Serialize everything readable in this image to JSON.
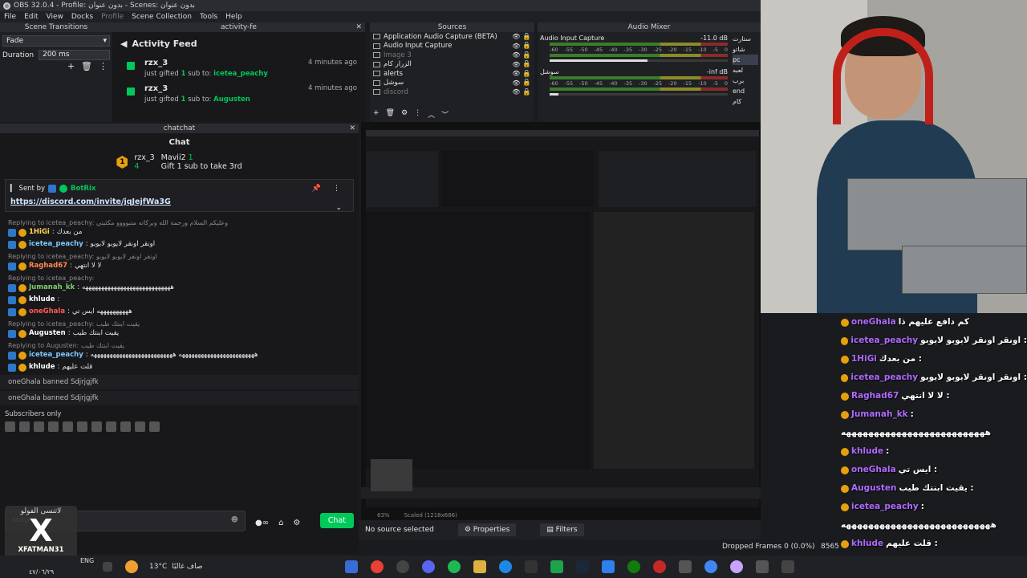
{
  "window": {
    "title": "OBS 32.0.4 - Profile: بدون عنوان - Scenes: بدون عنوان"
  },
  "menu": [
    "File",
    "Edit",
    "View",
    "Docks",
    "Profile",
    "Scene Collection",
    "Tools",
    "Help"
  ],
  "docks": {
    "scene_transitions": "Scene Transitions",
    "activity_feed_title": "activity-fe",
    "sources": "Sources",
    "audio_mixer": "Audio Mixer",
    "chat_dock": "chatchat"
  },
  "transitions": {
    "type": "Fade",
    "duration_label": "Duration",
    "duration_value": "200 ms"
  },
  "activity": {
    "heading": "Activity Feed",
    "items": [
      {
        "user": "rzx_3",
        "prefix": "just gifted",
        "count": "1",
        "mid": "sub to:",
        "target": "icetea_peachy",
        "time": "4 minutes ago"
      },
      {
        "user": "rzx_3",
        "prefix": "just gifted",
        "count": "1",
        "mid": "sub to:",
        "target": "Augusten",
        "time": "4 minutes ago"
      }
    ]
  },
  "sources": [
    {
      "name": "Application Audio Capture (BETA)",
      "dim": false
    },
    {
      "name": "Audio Input Capture",
      "dim": false
    },
    {
      "name": "Image 3",
      "dim": true
    },
    {
      "name": "الزرار كام",
      "dim": false
    },
    {
      "name": "alerts",
      "dim": false
    },
    {
      "name": "سوشل",
      "dim": false
    },
    {
      "name": "discord",
      "dim": true
    }
  ],
  "mixer": {
    "channels": [
      {
        "name": "Audio Input Capture",
        "db": "-11.0 dB",
        "level": 0.55
      },
      {
        "name": "سوشل",
        "db": "-inf dB",
        "level": 0.05
      }
    ],
    "ticks": [
      "-60",
      "-55",
      "-50",
      "-45",
      "-40",
      "-35",
      "-30",
      "-25",
      "-20",
      "-15",
      "-10",
      "-5",
      "0"
    ]
  },
  "scenes": [
    "ستارت",
    "شاتو",
    "pc",
    "لعبه",
    "برب",
    "end",
    "كام"
  ],
  "scenes_selected": "pc",
  "chat": {
    "heading": "Chat",
    "hype_rank": "1",
    "hype_user1": "rzx_3",
    "hype_user1_val": "4",
    "hype_user2": "Mavii2",
    "hype_user2_val": "1",
    "hype_sub": "Gift 1 sub to take 3rd",
    "pinned_label": "Sent by",
    "pinned_user": "BotRix",
    "pinned_link": "https://discord.com/invite/jqJejfWa3G",
    "messages": [
      {
        "kind": "reply",
        "text": "Replying to icetea_peachy: وعليكم السلام ورحمة الله وبركاته متبوووو مكثيني"
      },
      {
        "kind": "msg",
        "user": "1HiGi",
        "color": "#ffd84d",
        "text": "من بعدك"
      },
      {
        "kind": "msg",
        "user": "icetea_peachy",
        "color": "#7ec8ff",
        "text": "اونقر اونقر لايوبو لايوبو"
      },
      {
        "kind": "reply",
        "text": "Replying to icetea_peachy: اونقر اونقر لايوبو لايوبو"
      },
      {
        "kind": "msg",
        "user": "Raghad67",
        "color": "#ff8a4d",
        "text": "لا لا انتهي"
      },
      {
        "kind": "reply",
        "text": "Replying to icetea_peachy:"
      },
      {
        "kind": "msg",
        "user": "Jumanah_kk",
        "color": "#7ecf6a",
        "text": "ههههههههههههههههههههههههههههه"
      },
      {
        "kind": "msg",
        "user": "khlude",
        "color": "#ffffff",
        "text": ""
      },
      {
        "kind": "msg",
        "user": "oneGhala",
        "color": "#ff5a5a",
        "text": "ههههههههههه ايس تي"
      },
      {
        "kind": "reply",
        "text": "Replying to icetea_peachy: يقيت ابنتك طيب"
      },
      {
        "kind": "msg",
        "user": "Augusten",
        "color": "#ffffff",
        "text": "يقيت ابنتك طيب"
      },
      {
        "kind": "reply",
        "text": "Replying to Augusten: يقيت ابنتك طيب"
      },
      {
        "kind": "msg",
        "user": "icetea_peachy",
        "color": "#7ec8ff",
        "text": "ههههههههههههههههههههههههه ههههههههههههههههههههههههههه"
      },
      {
        "kind": "msg",
        "user": "khlude",
        "color": "#ffffff",
        "text": "قلت عليهم"
      }
    ],
    "system": [
      "oneGhala banned Sdjrjgjfk",
      "oneGhala banned Sdjrjgjfk"
    ],
    "subs_only": "Subscribers only",
    "input_placeholder": "ssage",
    "send_label": "Chat"
  },
  "preview": {
    "zoom": "63%",
    "scaled": "Scaled (1218x686)"
  },
  "bottom": {
    "no_source": "No source selected",
    "properties": "Properties",
    "filters": "Filters",
    "dropped": "Dropped Frames 0 (0.0%)",
    "bitrate": "8565"
  },
  "overlay": [
    {
      "user": "oneGhala",
      "text": "كم دافع عليهم ذا"
    },
    {
      "user": "icetea_peachy",
      "text": "اونقر اونقر لايوبو لايوبو :"
    },
    {
      "user": "1HiGi",
      "text": "من بعدك :"
    },
    {
      "user": "icetea_peachy",
      "text": "اونقر اونقر لايوبو لايوبو :"
    },
    {
      "user": "Raghad67",
      "text": "لا لا انتهي :"
    },
    {
      "user": "Jumanah_kk",
      "text": ":"
    },
    {
      "user": "",
      "text": "ههههههههههههههههههههههههههه"
    },
    {
      "user": "khlude",
      "text": ":"
    },
    {
      "user": "oneGhala",
      "text": "ايس تي :"
    },
    {
      "user": "Augusten",
      "text": "يقيت ابنتك طيب :"
    },
    {
      "user": "icetea_peachy",
      "text": ":"
    },
    {
      "user": "",
      "text": "هههههههههههههههههههههههههههه"
    },
    {
      "user": "khlude",
      "text": "قلت عليهم :"
    }
  ],
  "taskbar": {
    "temp": "13°C",
    "weather": "صاف غالبًا",
    "date": "٤٧/٠٦/٢٩",
    "lang": "ENG"
  },
  "watermark": {
    "top": "لاتنسى الفولو",
    "name": "XFATMAN31"
  }
}
